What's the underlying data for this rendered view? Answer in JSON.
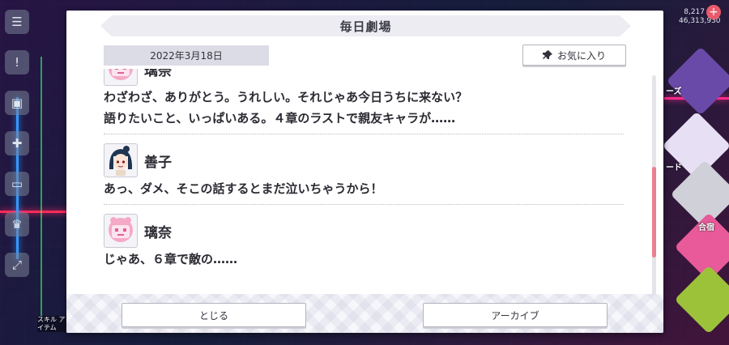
{
  "hud": {
    "count_top": "8,217",
    "count_bottom": "46,313,930",
    "label_series": "ーズ",
    "label_card": "ード",
    "label_gacha": "合宿",
    "label_item": "スキル\nアイテム"
  },
  "dialog": {
    "title": "毎日劇場",
    "date": "2022年3月18日",
    "favorite_label": "お気に入り",
    "close_label": "とじる",
    "archive_label": "アーカイブ"
  },
  "entries": [
    {
      "speaker": "璃奈",
      "avatar": "rina-avatar",
      "lines": [
        "わざわざ、ありがとう。うれしい。それじゃあ今日うちに来ない？",
        "語りたいこと、いっぱいある。４章のラストで親友キャラが……"
      ]
    },
    {
      "speaker": "善子",
      "avatar": "yoshiko-avatar",
      "lines": [
        "あっ、ダメ、そこの話するとまだ泣いちゃうから！"
      ]
    },
    {
      "speaker": "璃奈",
      "avatar": "rina-avatar",
      "lines": [
        "じゃあ、６章で敵の……"
      ]
    }
  ],
  "scroll": {
    "position_fraction": 0.42
  },
  "icons": {
    "favorite": "pin-icon",
    "side_menu": [
      "menu-icon",
      "chat-icon",
      "present-icon",
      "gift-icon",
      "photo-icon",
      "trophy-icon",
      "expand-icon"
    ]
  },
  "colors": {
    "accent_pink": "#ea8090",
    "panel_bg": "#ffffff",
    "title_bg": "#ececf2"
  }
}
